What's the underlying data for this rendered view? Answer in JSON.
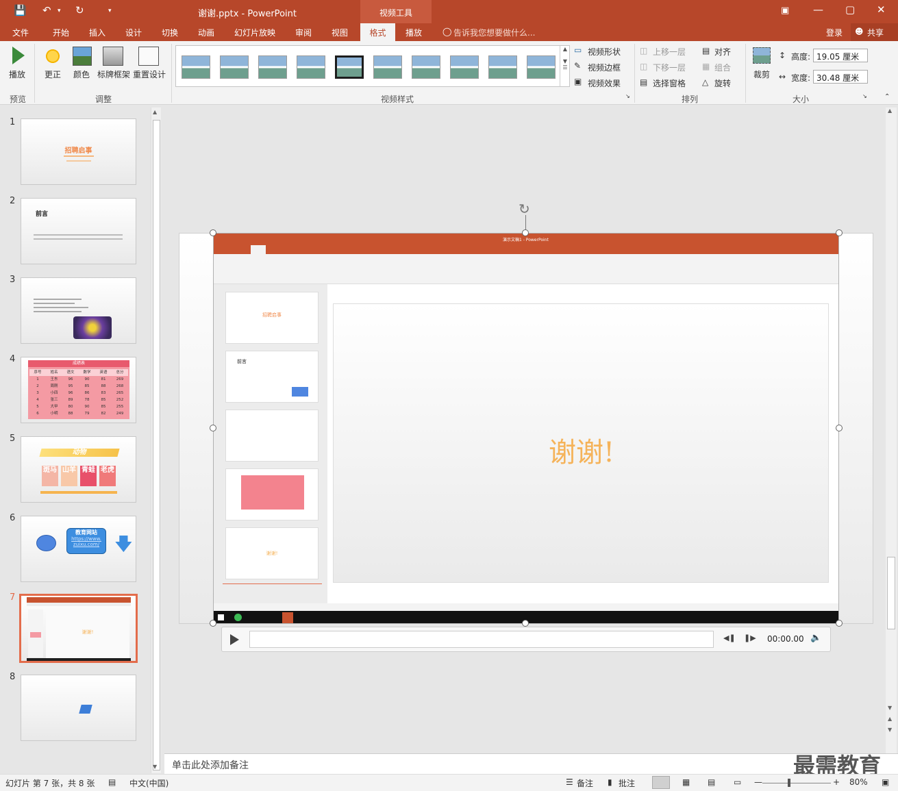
{
  "titlebar": {
    "doc_title": "谢谢.pptx - PowerPoint",
    "context_tab": "视频工具"
  },
  "menu": {
    "tabs": [
      "文件",
      "开始",
      "插入",
      "设计",
      "切换",
      "动画",
      "幻灯片放映",
      "审阅",
      "视图",
      "格式",
      "播放"
    ],
    "active": "格式",
    "tellme": "告诉我您想要做什么...",
    "login": "登录",
    "share": "共享"
  },
  "ribbon": {
    "play": "播放",
    "correct": "更正",
    "color": "颜色",
    "poster_frame": "标牌框架",
    "reset_design": "重置设计",
    "group_preview": "预览",
    "group_adjust": "调整",
    "group_styles": "视频样式",
    "video_shape": "视频形状",
    "video_border": "视频边框",
    "video_effects": "视频效果",
    "bring_forward": "上移一层",
    "send_backward": "下移一层",
    "selection_pane": "选择窗格",
    "align": "对齐",
    "group": "组合",
    "rotate": "旋转",
    "group_arrange": "排列",
    "crop": "裁剪",
    "height_label": "高度:",
    "height_value": "19.05 厘米",
    "width_label": "宽度:",
    "width_value": "30.48 厘米",
    "group_size": "大小"
  },
  "slides": {
    "numbers": [
      "1",
      "2",
      "3",
      "4",
      "5",
      "6",
      "7",
      "8"
    ],
    "s1_title": "招聘启事",
    "s2_title": "前言",
    "s4_header": "成绩表",
    "s4_cols": [
      "序号",
      "姓名",
      "语文",
      "数学",
      "英语",
      "总分"
    ],
    "s4_rows": [
      [
        "1",
        "王东",
        "96",
        "90",
        "81",
        "269"
      ],
      [
        "2",
        "周刚",
        "95",
        "85",
        "88",
        "268"
      ],
      [
        "3",
        "小四",
        "96",
        "86",
        "83",
        "265"
      ],
      [
        "4",
        "张三",
        "89",
        "78",
        "85",
        "252"
      ],
      [
        "5",
        "大甲",
        "80",
        "90",
        "85",
        "255"
      ],
      [
        "6",
        "小明",
        "88",
        "79",
        "82",
        "249"
      ]
    ],
    "s5_title": "动物",
    "s5_cards": [
      "斑马",
      "山羊",
      "青蛙",
      "老虎"
    ],
    "s6_box": "教育网站",
    "s6_link1": "https://www.",
    "s6_link2": "zuixu.com/",
    "s7_text": "谢谢!"
  },
  "video": {
    "inner_title": "演示文稿1 - PowerPoint",
    "thanks": "谢谢!",
    "time": "00:00.00"
  },
  "notes_placeholder": "单击此处添加备注",
  "status": {
    "slide_info": "幻灯片 第 7 张，共 8 张",
    "language": "中文(中国)",
    "notes": "备注",
    "comments": "批注",
    "zoom": "80%"
  },
  "watermark": "最需教育"
}
